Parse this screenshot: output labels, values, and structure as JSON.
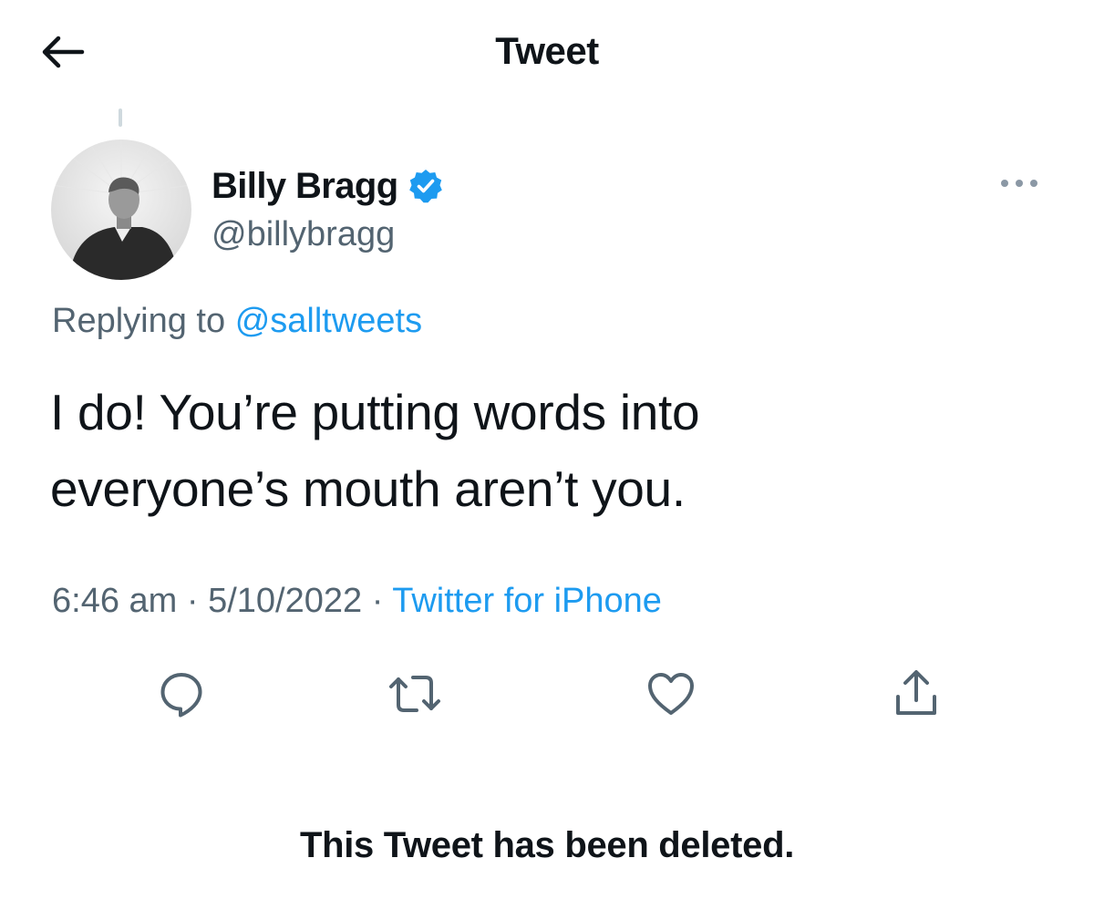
{
  "header": {
    "title": "Tweet",
    "back_icon": "arrow-left-icon"
  },
  "tweet": {
    "author": {
      "display_name": "Billy Bragg",
      "handle": "@billybragg",
      "verified": true,
      "verified_color": "#1d9bf0"
    },
    "replying_label": "Replying to",
    "replying_to": "@salltweets",
    "text": "I do! You’re putting words into\neveryone’s mouth aren’t you.",
    "time": "6:46 am",
    "separator": " · ",
    "date": "5/10/2022",
    "source": "Twitter for iPhone",
    "actions": [
      {
        "name": "reply-icon"
      },
      {
        "name": "retweet-icon"
      },
      {
        "name": "like-icon"
      },
      {
        "name": "share-icon"
      }
    ]
  },
  "notice": "This Tweet has been deleted.",
  "colors": {
    "text": "#0f1419",
    "secondary": "#536471",
    "link": "#1d9bf0",
    "divider": "#cfd9de"
  }
}
